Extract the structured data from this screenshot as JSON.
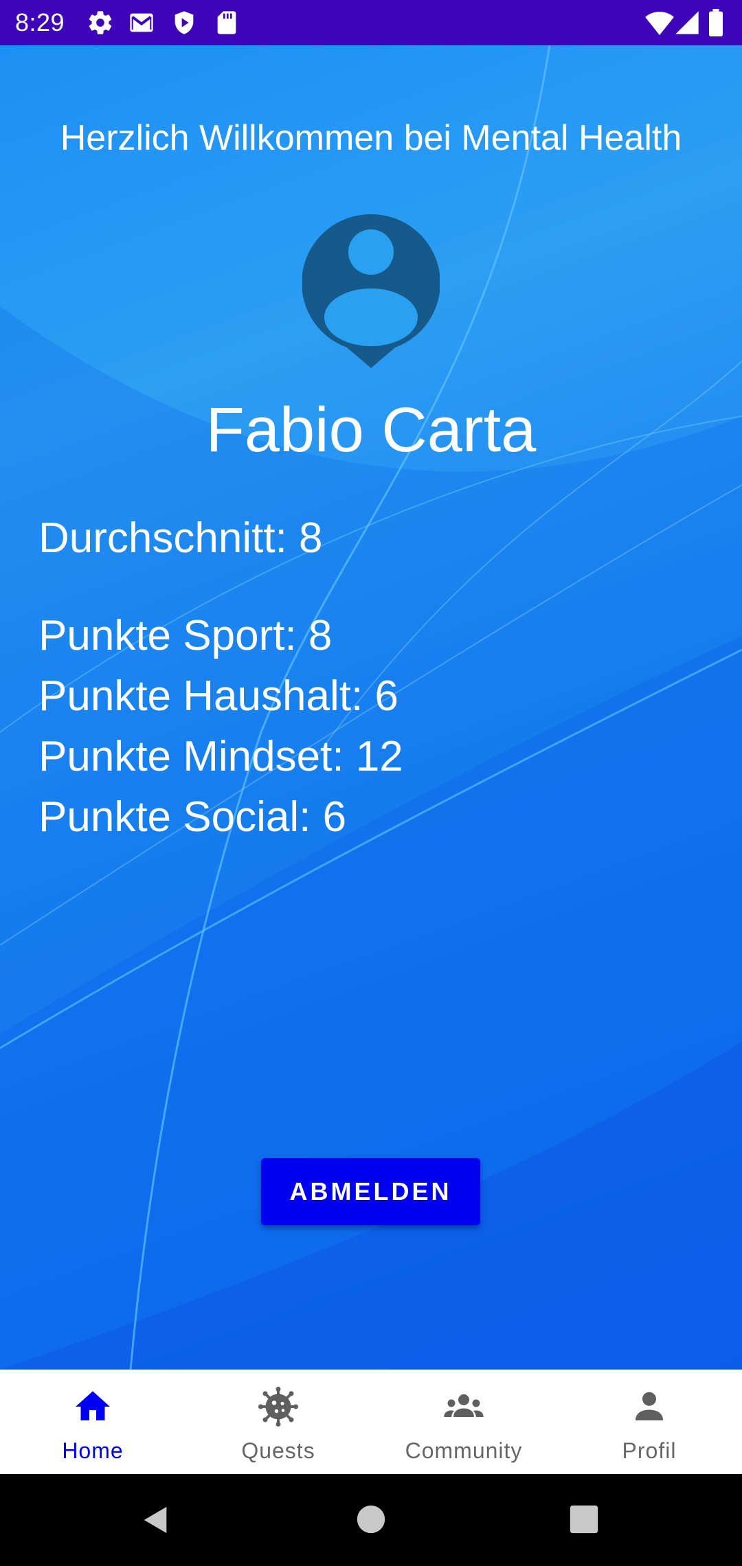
{
  "status_bar": {
    "time": "8:29",
    "left_icons": [
      "settings-icon",
      "gmail-icon",
      "shield-icon",
      "sd-card-icon"
    ],
    "right_icons": [
      "wifi-icon",
      "cell-signal-icon",
      "battery-icon"
    ],
    "background": "#3d04b8"
  },
  "home": {
    "welcome": "Herzlich Willkommen bei Mental Health",
    "user_name": "Fabio Carta",
    "average": "Durchschnitt: 8",
    "stats": {
      "sport": "Punkte Sport: 8",
      "haushalt": "Punkte Haushalt: 6",
      "mindset": "Punkte Mindset: 12",
      "social": "Punkte Social: 6"
    },
    "logout_label": "ABMELDEN"
  },
  "bottom_nav": {
    "items": [
      {
        "label": "Home",
        "icon": "home-icon",
        "active": true
      },
      {
        "label": "Quests",
        "icon": "virus-icon",
        "active": false
      },
      {
        "label": "Community",
        "icon": "group-icon",
        "active": false
      },
      {
        "label": "Profil",
        "icon": "person-icon",
        "active": false
      }
    ]
  },
  "colors": {
    "accent": "#0000f2",
    "inactive_nav": "#666666",
    "avatar": "#155a8a",
    "background_top": "#1d8ff4",
    "background_bottom": "#0c63ef"
  }
}
